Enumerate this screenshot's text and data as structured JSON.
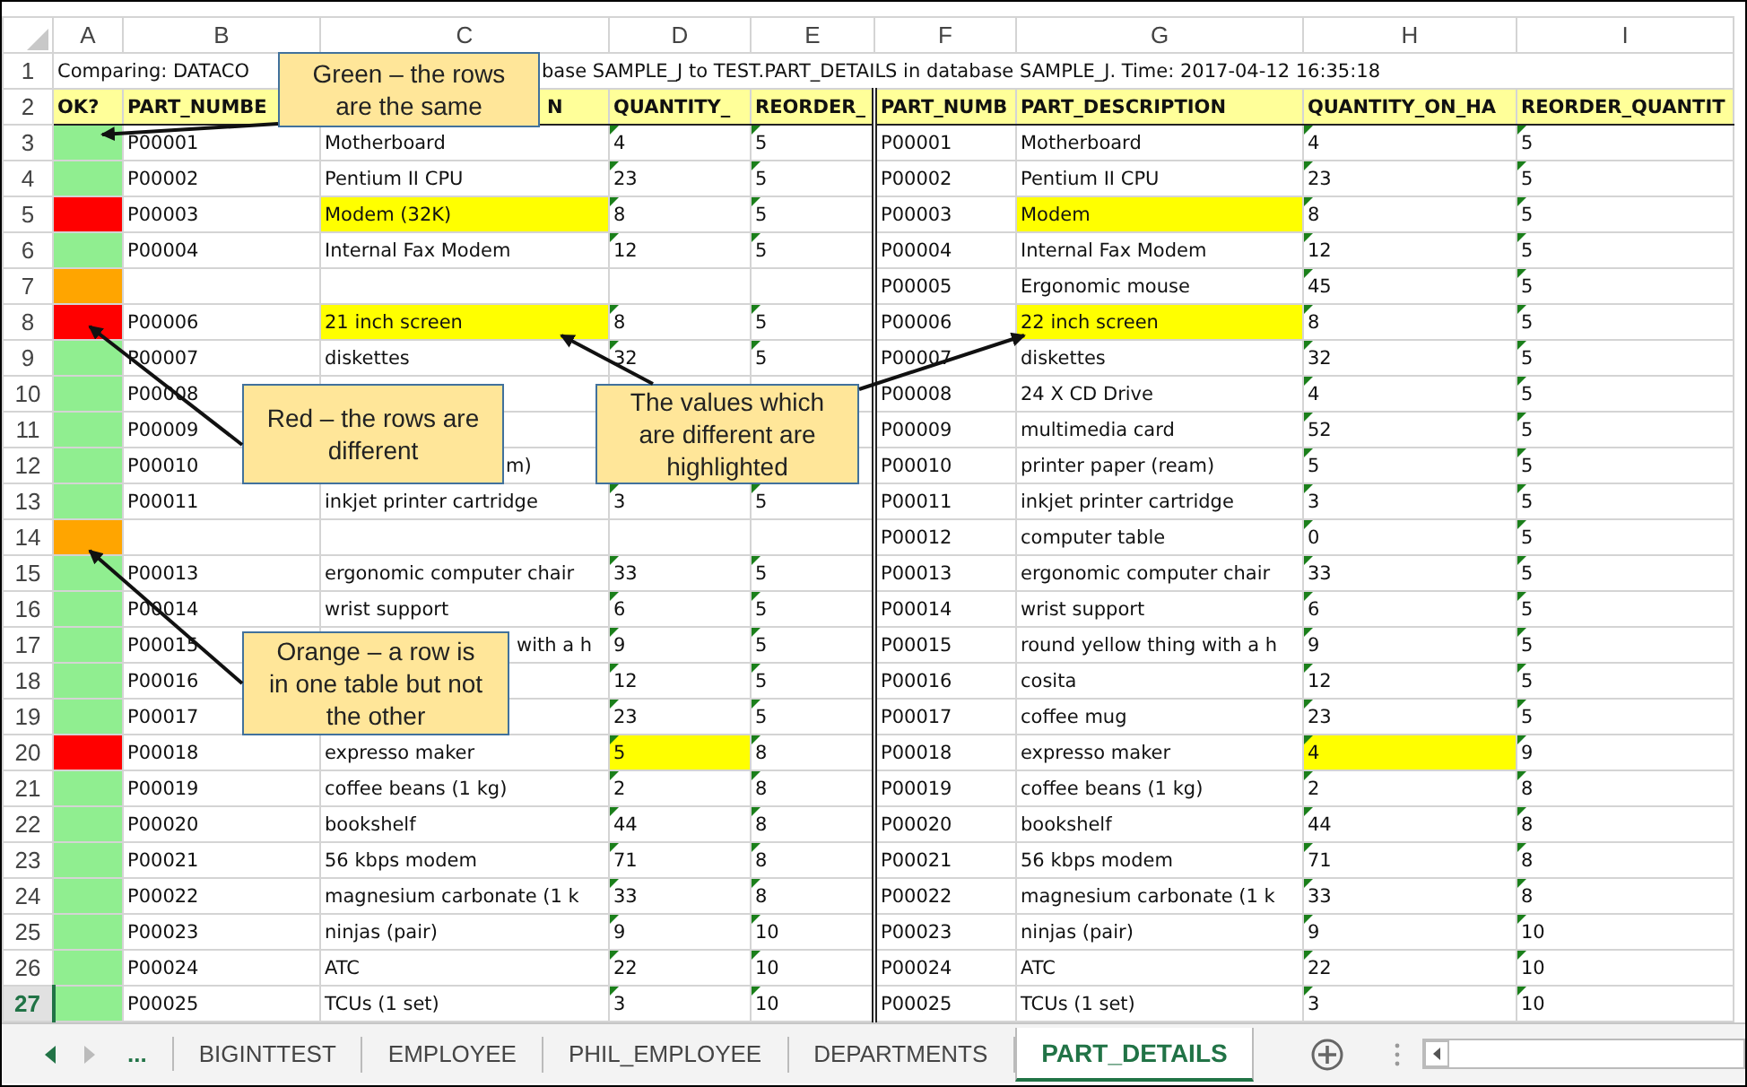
{
  "sheet": {
    "column_letters": [
      "A",
      "B",
      "C",
      "D",
      "E",
      "F",
      "G",
      "H",
      "I"
    ],
    "row_numbers": [
      {
        "label": "1",
        "selected": false
      },
      {
        "label": "2",
        "selected": false
      },
      {
        "label": "3",
        "selected": false
      },
      {
        "label": "4",
        "selected": false
      },
      {
        "label": "5",
        "selected": false
      },
      {
        "label": "6",
        "selected": false
      },
      {
        "label": "7",
        "selected": false
      },
      {
        "label": "8",
        "selected": false
      },
      {
        "label": "9",
        "selected": false
      },
      {
        "label": "10",
        "selected": false
      },
      {
        "label": "11",
        "selected": false
      },
      {
        "label": "12",
        "selected": false
      },
      {
        "label": "13",
        "selected": false
      },
      {
        "label": "14",
        "selected": false
      },
      {
        "label": "15",
        "selected": false
      },
      {
        "label": "16",
        "selected": false
      },
      {
        "label": "17",
        "selected": false
      },
      {
        "label": "18",
        "selected": false
      },
      {
        "label": "19",
        "selected": false
      },
      {
        "label": "20",
        "selected": false
      },
      {
        "label": "21",
        "selected": false
      },
      {
        "label": "22",
        "selected": false
      },
      {
        "label": "23",
        "selected": false
      },
      {
        "label": "24",
        "selected": false
      },
      {
        "label": "25",
        "selected": false
      },
      {
        "label": "26",
        "selected": false
      },
      {
        "label": "27",
        "selected": true
      }
    ],
    "title_row": {
      "text_start": "Comparing: DATACO",
      "text_end": "base SAMPLE_J to TEST.PART_DETAILS in database SAMPLE_J. Time: 2017-04-12 16:35:18"
    },
    "header_row": {
      "status_label": "OK?",
      "left": {
        "part_number": "PART_NUMBE",
        "part_description": "N",
        "quantity": "QUANTITY_",
        "reorder": "REORDER_"
      },
      "right": {
        "part_number": "PART_NUMB",
        "part_description": "PART_DESCRIPTION",
        "quantity": "QUANTITY_ON_HA",
        "reorder": "REORDER_QUANTIT"
      }
    },
    "rows": [
      {
        "color": "#90ee90",
        "description_differs": false,
        "quantity_differs": false,
        "left": {
          "part_number": "P00001",
          "part_description": "Motherboard",
          "quantity": "4",
          "reorder": "5"
        },
        "right": {
          "part_number": "P00001",
          "part_description": "Motherboard",
          "quantity": "4",
          "reorder": "5"
        }
      },
      {
        "color": "#90ee90",
        "description_differs": false,
        "quantity_differs": false,
        "left": {
          "part_number": "P00002",
          "part_description": "Pentium II CPU",
          "quantity": "23",
          "reorder": "5"
        },
        "right": {
          "part_number": "P00002",
          "part_description": "Pentium II CPU",
          "quantity": "23",
          "reorder": "5"
        }
      },
      {
        "color": "#ff0000",
        "description_differs": true,
        "quantity_differs": false,
        "left": {
          "part_number": "P00003",
          "part_description": "Modem (32K)",
          "quantity": "8",
          "reorder": "5"
        },
        "right": {
          "part_number": "P00003",
          "part_description": "Modem",
          "quantity": "8",
          "reorder": "5"
        }
      },
      {
        "color": "#90ee90",
        "description_differs": false,
        "quantity_differs": false,
        "left": {
          "part_number": "P00004",
          "part_description": "Internal Fax Modem",
          "quantity": "12",
          "reorder": "5"
        },
        "right": {
          "part_number": "P00004",
          "part_description": "Internal Fax Modem",
          "quantity": "12",
          "reorder": "5"
        }
      },
      {
        "color": "#ffa500",
        "description_differs": false,
        "quantity_differs": false,
        "right": {
          "part_number": "P00005",
          "part_description": "Ergonomic mouse",
          "quantity": "45",
          "reorder": "5"
        }
      },
      {
        "color": "#ff0000",
        "description_differs": true,
        "quantity_differs": false,
        "left": {
          "part_number": "P00006",
          "part_description": "21 inch screen",
          "quantity": "8",
          "reorder": "5"
        },
        "right": {
          "part_number": "P00006",
          "part_description": "22 inch screen",
          "quantity": "8",
          "reorder": "5"
        }
      },
      {
        "color": "#90ee90",
        "description_differs": false,
        "quantity_differs": false,
        "left": {
          "part_number": "P00007",
          "part_description": "diskettes",
          "quantity": "32",
          "reorder": "5"
        },
        "right": {
          "part_number": "P00007",
          "part_description": "diskettes",
          "quantity": "32",
          "reorder": "5"
        }
      },
      {
        "color": "#90ee90",
        "description_differs": false,
        "quantity_differs": false,
        "left": {
          "part_number": "P00008"
        },
        "right": {
          "part_number": "P00008",
          "part_description": "24 X CD Drive",
          "quantity": "4",
          "reorder": "5"
        }
      },
      {
        "color": "#90ee90",
        "description_differs": false,
        "quantity_differs": false,
        "left": {
          "part_number": "P00009"
        },
        "right": {
          "part_number": "P00009",
          "part_description": "multimedia card",
          "quantity": "52",
          "reorder": "5"
        }
      },
      {
        "color": "#90ee90",
        "description_differs": false,
        "quantity_differs": false,
        "left": {
          "part_number": "P00010",
          "part_description": "m)"
        },
        "right": {
          "part_number": "P00010",
          "part_description": "printer paper (ream)",
          "quantity": "5",
          "reorder": "5"
        }
      },
      {
        "color": "#90ee90",
        "description_differs": false,
        "quantity_differs": false,
        "left": {
          "part_number": "P00011",
          "part_description": "inkjet printer cartridge",
          "quantity": "3",
          "reorder": "5"
        },
        "right": {
          "part_number": "P00011",
          "part_description": "inkjet printer cartridge",
          "quantity": "3",
          "reorder": "5"
        }
      },
      {
        "color": "#ffa500",
        "description_differs": false,
        "quantity_differs": false,
        "right": {
          "part_number": "P00012",
          "part_description": "computer table",
          "quantity": "0",
          "reorder": "5"
        }
      },
      {
        "color": "#90ee90",
        "description_differs": false,
        "quantity_differs": false,
        "left": {
          "part_number": "P00013",
          "part_description": "ergonomic computer chair",
          "quantity": "33",
          "reorder": "5"
        },
        "right": {
          "part_number": "P00013",
          "part_description": "ergonomic computer chair",
          "quantity": "33",
          "reorder": "5"
        }
      },
      {
        "color": "#90ee90",
        "description_differs": false,
        "quantity_differs": false,
        "left": {
          "part_number": "P00014",
          "part_description": "wrist support",
          "quantity": "6",
          "reorder": "5"
        },
        "right": {
          "part_number": "P00014",
          "part_description": "wrist support",
          "quantity": "6",
          "reorder": "5"
        }
      },
      {
        "color": "#90ee90",
        "description_differs": false,
        "quantity_differs": false,
        "left": {
          "part_number": "P00015",
          "part_description": "with a h",
          "quantity": "9",
          "reorder": "5"
        },
        "right": {
          "part_number": "P00015",
          "part_description": "round yellow thing with a h",
          "quantity": "9",
          "reorder": "5"
        }
      },
      {
        "color": "#90ee90",
        "description_differs": false,
        "quantity_differs": false,
        "left": {
          "part_number": "P00016",
          "quantity": "12",
          "reorder": "5"
        },
        "right": {
          "part_number": "P00016",
          "part_description": "cosita",
          "quantity": "12",
          "reorder": "5"
        }
      },
      {
        "color": "#90ee90",
        "description_differs": false,
        "quantity_differs": false,
        "left": {
          "part_number": "P00017",
          "quantity": "23",
          "reorder": "5"
        },
        "right": {
          "part_number": "P00017",
          "part_description": "coffee mug",
          "quantity": "23",
          "reorder": "5"
        }
      },
      {
        "color": "#ff0000",
        "description_differs": false,
        "quantity_differs": true,
        "left": {
          "part_number": "P00018",
          "part_description": "expresso maker",
          "quantity": "5",
          "reorder": "8"
        },
        "right": {
          "part_number": "P00018",
          "part_description": "expresso maker",
          "quantity": "4",
          "reorder": "9"
        }
      },
      {
        "color": "#90ee90",
        "description_differs": false,
        "quantity_differs": false,
        "left": {
          "part_number": "P00019",
          "part_description": "coffee beans (1 kg)",
          "quantity": "2",
          "reorder": "8"
        },
        "right": {
          "part_number": "P00019",
          "part_description": "coffee beans (1 kg)",
          "quantity": "2",
          "reorder": "8"
        }
      },
      {
        "color": "#90ee90",
        "description_differs": false,
        "quantity_differs": false,
        "left": {
          "part_number": "P00020",
          "part_description": "bookshelf",
          "quantity": "44",
          "reorder": "8"
        },
        "right": {
          "part_number": "P00020",
          "part_description": "bookshelf",
          "quantity": "44",
          "reorder": "8"
        }
      },
      {
        "color": "#90ee90",
        "description_differs": false,
        "quantity_differs": false,
        "left": {
          "part_number": "P00021",
          "part_description": "56 kbps modem",
          "quantity": "71",
          "reorder": "8"
        },
        "right": {
          "part_number": "P00021",
          "part_description": "56 kbps modem",
          "quantity": "71",
          "reorder": "8"
        }
      },
      {
        "color": "#90ee90",
        "description_differs": false,
        "quantity_differs": false,
        "left": {
          "part_number": "P00022",
          "part_description": "magnesium carbonate (1 k",
          "quantity": "33",
          "reorder": "8"
        },
        "right": {
          "part_number": "P00022",
          "part_description": "magnesium carbonate (1 k",
          "quantity": "33",
          "reorder": "8"
        }
      },
      {
        "color": "#90ee90",
        "description_differs": false,
        "quantity_differs": false,
        "left": {
          "part_number": "P00023",
          "part_description": "ninjas (pair)",
          "quantity": "9",
          "reorder": "10"
        },
        "right": {
          "part_number": "P00023",
          "part_description": "ninjas (pair)",
          "quantity": "9",
          "reorder": "10"
        }
      },
      {
        "color": "#90ee90",
        "description_differs": false,
        "quantity_differs": false,
        "left": {
          "part_number": "P00024",
          "part_description": "ATC",
          "quantity": "22",
          "reorder": "10"
        },
        "right": {
          "part_number": "P00024",
          "part_description": "ATC",
          "quantity": "22",
          "reorder": "10"
        }
      },
      {
        "color": "#90ee90",
        "description_differs": false,
        "quantity_differs": false,
        "left": {
          "part_number": "P00025",
          "part_description": "TCUs (1 set)",
          "quantity": "3",
          "reorder": "10"
        },
        "right": {
          "part_number": "P00025",
          "part_description": "TCUs (1 set)",
          "quantity": "3",
          "reorder": "10"
        }
      }
    ]
  },
  "callouts": [
    {
      "text": "Green – the rows are the same"
    },
    {
      "text": "Red – the rows are different"
    },
    {
      "text": "The values which are different are highlighted"
    },
    {
      "text": "Orange – a row is in one table but not the other"
    }
  ],
  "sheet_tabs": {
    "more": "...",
    "tabs": [
      {
        "label": "BIGINTTEST",
        "selected": false
      },
      {
        "label": "EMPLOYEE",
        "selected": false
      },
      {
        "label": "PHIL_EMPLOYEE",
        "selected": false
      },
      {
        "label": "DEPARTMENTS",
        "selected": false
      },
      {
        "label": "PART_DETAILS",
        "selected": true
      }
    ]
  }
}
